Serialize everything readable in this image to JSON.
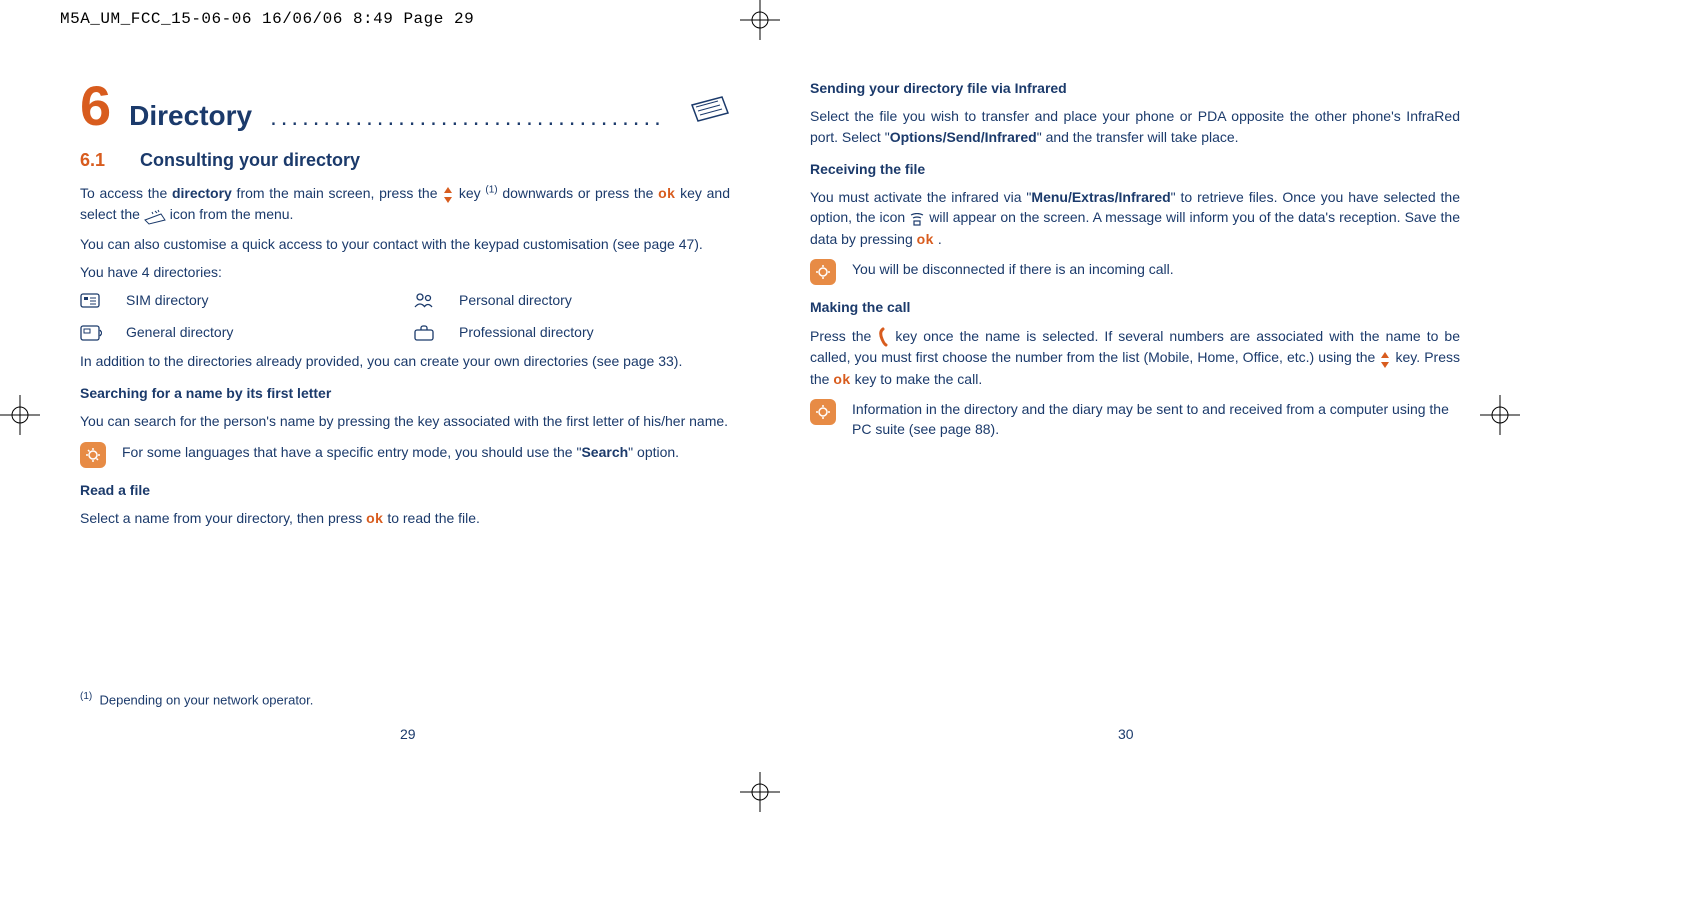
{
  "header": {
    "slug": "M5A_UM_FCC_15-06-06  16/06/06  8:49  Page 29"
  },
  "left": {
    "chapter_num": "6",
    "chapter_title": "Directory",
    "chapter_dots": ".....................................",
    "section_num": "6.1",
    "section_title": "Consulting your directory",
    "p_access_1": "To access the ",
    "p_access_b1": "directory",
    "p_access_2": " from the main screen, press the ",
    "p_access_3": " key ",
    "p_access_sup": "(1)",
    "p_access_4": " downwards or press the ",
    "p_access_ok": "ok",
    "p_access_5": " key and select the ",
    "p_access_6": " icon from the menu.",
    "p_custom": "You can also customise a quick access to your contact with the keypad customisation (see page 47).",
    "p_have": "You have 4 directories:",
    "dir1": "SIM directory",
    "dir2": "General directory",
    "dir3": "Personal directory",
    "dir4": "Professional directory",
    "p_addition": "In addition to the directories already provided, you can create your own directories (see page 33).",
    "h_search": "Searching for a name by its first letter",
    "p_search": "You can search for the person's name by pressing the key associated with the first letter of his/her name.",
    "tip_search_1": "For some languages that have a specific entry mode, you should use the \"",
    "tip_search_b": "Search",
    "tip_search_2": "\" option.",
    "h_read": "Read a file",
    "p_read_1": "Select a name from your directory, then press ",
    "p_read_ok": "ok",
    "p_read_2": " to read the file.",
    "footnote_sup": "(1)",
    "footnote": "Depending on your network operator.",
    "pagenum": "29"
  },
  "right": {
    "h_send": "Sending your directory file via Infrared",
    "p_send_1": "Select the file you wish to transfer and place your phone or PDA opposite the other phone's InfraRed port. Select \"",
    "p_send_b": "Options/Send/Infrared",
    "p_send_2": "\" and the transfer will take place.",
    "h_recv": "Receiving the file",
    "p_recv_1": "You must activate the infrared via \"",
    "p_recv_b": "Menu/Extras/Infrared",
    "p_recv_2": "\" to retrieve files. Once you have selected the option, the icon ",
    "p_recv_3": " will appear on the screen. A message will inform you of the data's reception. Save the data by pressing ",
    "p_recv_ok": "ok",
    "p_recv_4": " .",
    "tip_recv": "You will be disconnected if there is an incoming call.",
    "h_call": "Making the call",
    "p_call_1": "Press the ",
    "p_call_2": " key once the name is selected. If several numbers are associated with the name to be called, you must first choose the number from the list (Mobile, Home, Office, etc.) using the ",
    "p_call_3": " key. Press the ",
    "p_call_ok": "ok",
    "p_call_4": " key to make the call.",
    "tip_call": "Information in the directory and the diary may be sent to and received from a computer using the PC suite (see page 88).",
    "pagenum": "30"
  }
}
